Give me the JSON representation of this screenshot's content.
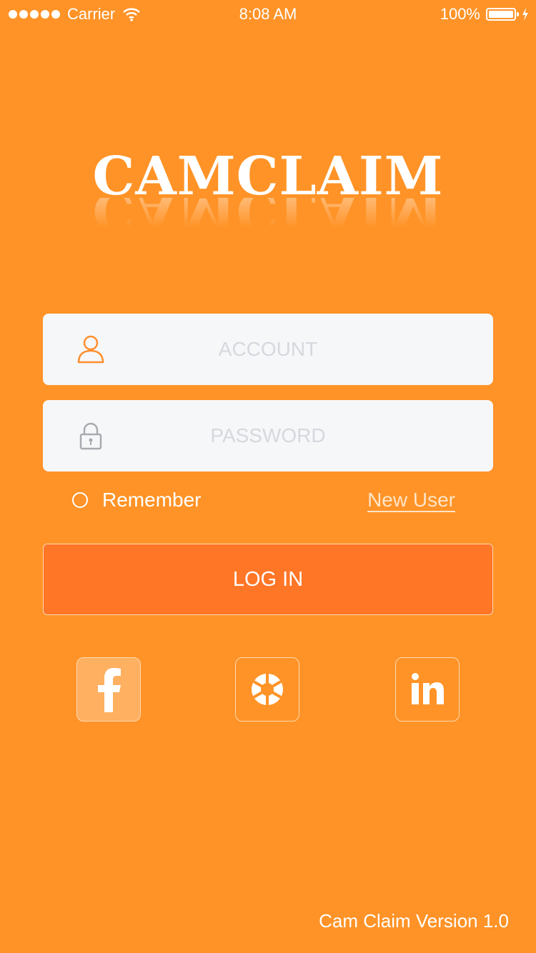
{
  "status_bar": {
    "carrier": "Carrier",
    "time": "8:08 AM",
    "battery": "100%"
  },
  "logo": {
    "text": "CAMCLAIM"
  },
  "form": {
    "account_placeholder": "ACCOUNT",
    "password_placeholder": "PASSWORD",
    "remember_label": "Remember",
    "new_user_label": "New User",
    "login_label": "LOG IN"
  },
  "social": [
    {
      "icon": "facebook-icon"
    },
    {
      "icon": "shutter-icon"
    },
    {
      "icon": "linkedin-icon"
    }
  ],
  "footer": {
    "version": "Cam Claim Version 1.0"
  },
  "colors": {
    "background": "#FF9327",
    "button": "#FF7627",
    "field": "#F6F7F9"
  }
}
